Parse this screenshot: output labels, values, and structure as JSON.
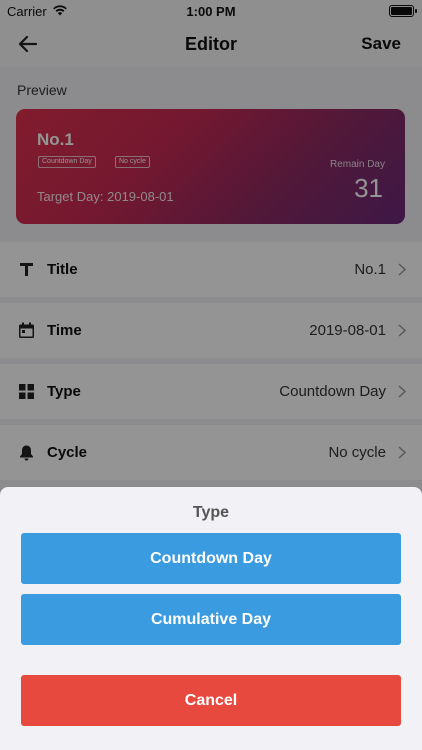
{
  "status_bar": {
    "carrier": "Carrier",
    "time": "1:00 PM"
  },
  "nav": {
    "title": "Editor",
    "save_label": "Save",
    "back_icon": "arrow-left-icon"
  },
  "preview": {
    "label": "Preview",
    "card": {
      "title": "No.1",
      "tags": [
        "Countdown Day",
        "No cycle"
      ],
      "target_label": "Target Day:",
      "target_date": "2019-08-01",
      "remain_label": "Remain Day",
      "remain_value": "31",
      "gradient_start": "#e0314f",
      "gradient_end": "#6a2a7a"
    }
  },
  "rows": [
    {
      "icon": "title-t-icon",
      "label": "Title",
      "value": "No.1"
    },
    {
      "icon": "calendar-icon",
      "label": "Time",
      "value": "2019-08-01"
    },
    {
      "icon": "grid-icon",
      "label": "Type",
      "value": "Countdown Day"
    },
    {
      "icon": "bell-icon",
      "label": "Cycle",
      "value": "No cycle"
    }
  ],
  "sheet": {
    "title": "Type",
    "options": [
      "Countdown Day",
      "Cumulative Day"
    ],
    "cancel_label": "Cancel",
    "option_color": "#3a9be0",
    "cancel_color": "#e8493e"
  }
}
